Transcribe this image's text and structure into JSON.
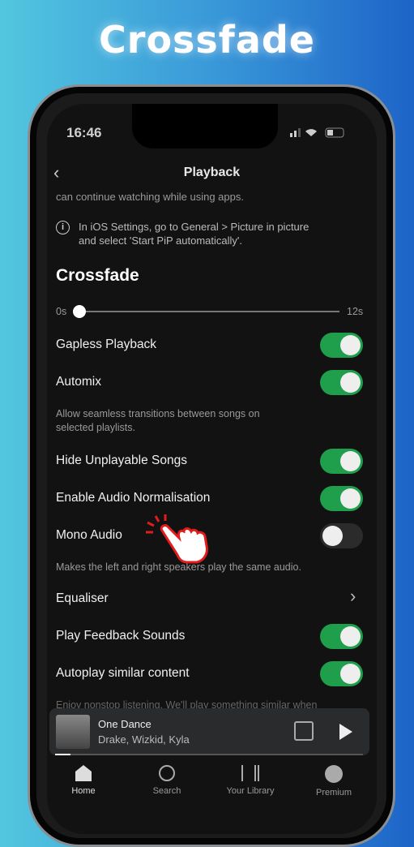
{
  "banner_title": "Crossfade",
  "status": {
    "time": "16:46"
  },
  "header": {
    "title": "Playback"
  },
  "pip_text": "can continue watching while using apps.",
  "pip_info": "In iOS Settings, go to General > Picture in picture and select 'Start PiP automatically'.",
  "crossfade": {
    "heading": "Crossfade",
    "min": "0s",
    "max": "12s",
    "value_s": 0
  },
  "settings": [
    {
      "label": "Gapless Playback",
      "on": true
    },
    {
      "label": "Automix",
      "on": true,
      "desc": "Allow seamless transitions between songs on selected playlists."
    },
    {
      "label": "Hide Unplayable Songs",
      "on": true
    },
    {
      "label": "Enable Audio Normalisation",
      "on": true
    },
    {
      "label": "Mono Audio",
      "on": false,
      "desc": "Makes the left and right speakers play the same audio."
    },
    {
      "label": "Equaliser"
    },
    {
      "label": "Play Feedback Sounds",
      "on": true
    },
    {
      "label": "Autoplay similar content",
      "on": true,
      "desc": "Enjoy nonstop listening. We'll play something similar when"
    }
  ],
  "player": {
    "title": "One Dance",
    "artist": "Drake, Wizkid, Kyla",
    "progress": 0.05
  },
  "nav": [
    {
      "label": "Home",
      "icon": "home-icon"
    },
    {
      "label": "Search",
      "icon": "search-icon"
    },
    {
      "label": "Your Library",
      "icon": "library-icon"
    },
    {
      "label": "Premium",
      "icon": "spotify-icon"
    }
  ],
  "colors": {
    "accent": "#1f9e4c",
    "background": "#121212"
  }
}
